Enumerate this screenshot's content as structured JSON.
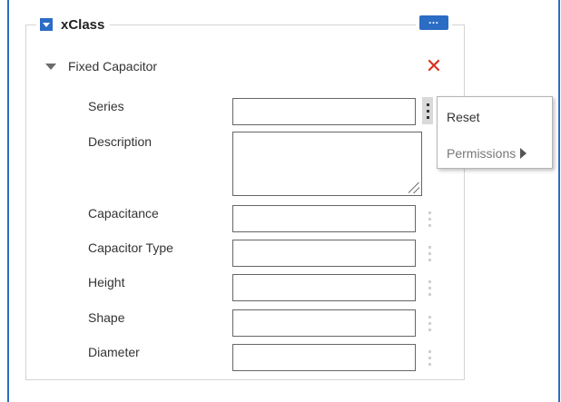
{
  "panel": {
    "title": "xClass",
    "more_button_label": "…"
  },
  "section": {
    "title": "Fixed Capacitor",
    "remove_icon": "✕"
  },
  "fields": [
    {
      "label": "Series",
      "value": ""
    },
    {
      "label": "Description",
      "value": ""
    },
    {
      "label": "Capacitance",
      "value": ""
    },
    {
      "label": "Capacitor Type",
      "value": ""
    },
    {
      "label": "Height",
      "value": ""
    },
    {
      "label": "Shape",
      "value": ""
    },
    {
      "label": "Diameter",
      "value": ""
    }
  ],
  "context_menu": {
    "items": [
      {
        "label": "Reset",
        "enabled": true
      },
      {
        "label": "Permissions",
        "enabled": false,
        "has_submenu": true
      }
    ]
  },
  "colors": {
    "accent": "#2b6cc4",
    "remove": "#d9331f",
    "border": "#d4d4d4"
  }
}
